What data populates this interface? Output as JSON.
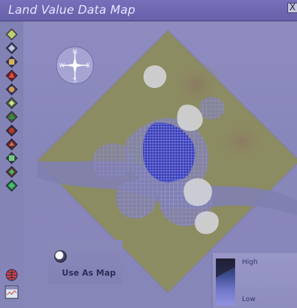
{
  "window": {
    "title": "Land Value Data Map",
    "close_label": "X"
  },
  "map": {
    "compass": {
      "north": "N",
      "south": "S",
      "west": "W",
      "east": "E"
    },
    "use_as_map_label": "Use As Map",
    "legend": {
      "high": "High",
      "low": "Low"
    }
  },
  "icons": {
    "close": "close-icon",
    "compass": "compass-icon",
    "radio": "radio-icon"
  },
  "colors": {
    "title_bar": "#6d67b2",
    "panel_bg": "#8a89bb",
    "map_land": "#8f8f63",
    "map_water": "#7d7db0",
    "map_blue_dense": "#3035b8",
    "map_light": "#d7d7da",
    "legend_dark": "#25223a",
    "legend_blue": "#7f81d6"
  }
}
